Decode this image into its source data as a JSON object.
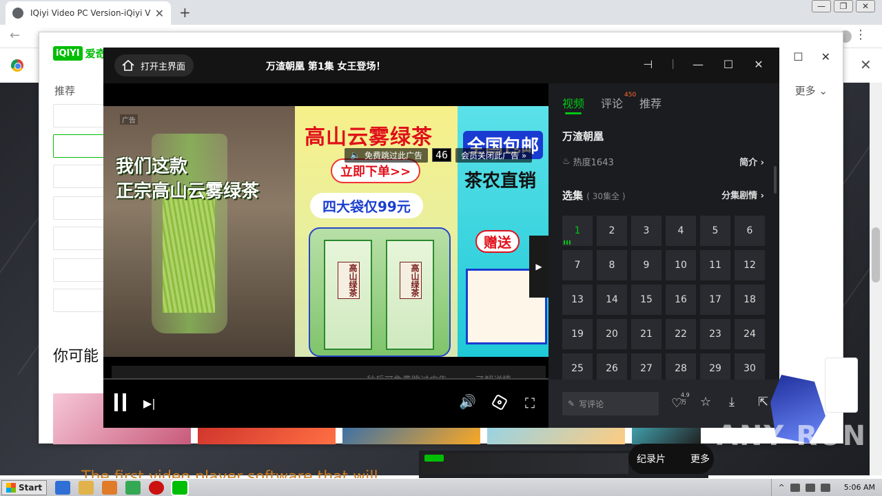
{
  "browser": {
    "tab_title": "IQiyi Video PC Version-iQiyi Video Of",
    "tab_close": "✕",
    "new_tab": "+"
  },
  "iqiyi_app": {
    "logo_badge": "iQIYI",
    "logo_name": "爱奇",
    "nav_recommend": "推荐",
    "nav_more": "更多",
    "you_may_like": "你可能",
    "promo_text": "The first video player software that will",
    "documentary_chip": "纪录片",
    "documentary_more": "更多"
  },
  "player": {
    "home_button": "打开主界面",
    "video_title": "万渣朝凰 第1集 女王登场！",
    "ad": {
      "free_skip": "免费跳过此广告",
      "countdown": "46",
      "vip_close": "会员关闭此广告 »",
      "ad_tag": "广告",
      "skip_hint": "秒后可免费跳过广告",
      "learn_more": "了解详情",
      "left_caption_line1": "我们这款",
      "left_caption_line2": "正宗高山云雾绿茶",
      "mid_title": "高山云雾绿茶",
      "mid_order": "立即下单>>",
      "mid_price": "四大袋仅99元",
      "bag_label": "高山绿茶",
      "right_mail": "全国包邮",
      "right_direct": "茶农直销",
      "right_gift": "赠送"
    },
    "panel": {
      "tabs": [
        {
          "label": "视频",
          "active": true
        },
        {
          "label": "评论",
          "badge": "450"
        },
        {
          "label": "推荐"
        }
      ],
      "show_name": "万渣朝凰",
      "heat": "热度1643",
      "intro": "简介",
      "episodes_label": "选集",
      "episodes_count": "( 30集全 )",
      "episode_plot": "分集剧情",
      "episodes": [
        "1",
        "2",
        "3",
        "4",
        "5",
        "6",
        "7",
        "8",
        "9",
        "10",
        "11",
        "12",
        "13",
        "14",
        "15",
        "16",
        "17",
        "18",
        "19",
        "20",
        "21",
        "22",
        "23",
        "24",
        "25",
        "26",
        "27",
        "28",
        "29",
        "30"
      ],
      "comment_placeholder": "写评论",
      "like_count": "4.9万"
    }
  },
  "watermark": "ANY RUN",
  "taskbar": {
    "start": "Start",
    "clock": "5:06 AM"
  },
  "colors": {
    "accent": "#00c814",
    "panel_bg": "#1b1c20",
    "brand": "#00be06"
  }
}
